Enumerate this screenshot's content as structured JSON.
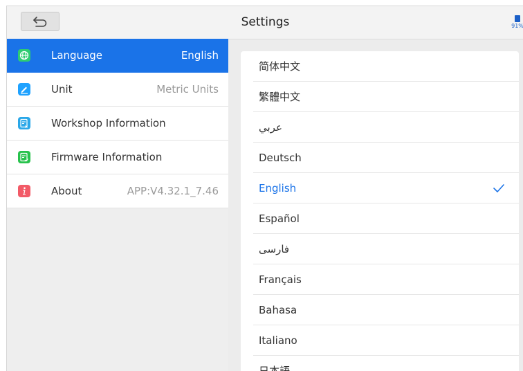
{
  "header": {
    "title": "Settings",
    "battery_percent": "91%"
  },
  "sidebar": {
    "items": [
      {
        "label": "Language",
        "value": "English",
        "active": true,
        "icon": "globe-icon",
        "icon_color": "#2ecc71"
      },
      {
        "label": "Unit",
        "value": "Metric Units",
        "icon": "pencil-icon",
        "icon_color": "#1fa2ff"
      },
      {
        "label": "Workshop Information",
        "value": "",
        "icon": "document-edit-icon",
        "icon_color": "#2aa7e8"
      },
      {
        "label": "Firmware Information",
        "value": "",
        "icon": "document-check-icon",
        "icon_color": "#27c24c"
      },
      {
        "label": "About",
        "value": "APP:V4.32.1_7.46",
        "icon": "info-icon",
        "icon_color": "#f25a67"
      }
    ]
  },
  "languages": [
    "简体中文",
    "繁體中文",
    "عربي",
    "Deutsch",
    "English",
    "Español",
    "فارسی",
    "Français",
    "Bahasa",
    "Italiano",
    "日本語"
  ],
  "selected_language": "English",
  "colors": {
    "accent": "#1a73e8"
  }
}
